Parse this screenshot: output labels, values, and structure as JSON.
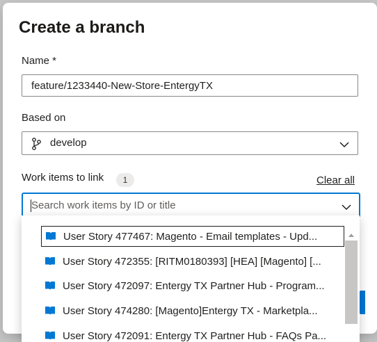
{
  "dialog": {
    "title": "Create a branch"
  },
  "name_field": {
    "label": "Name *",
    "value": "feature/1233440-New-Store-EntergyTX"
  },
  "based_on": {
    "label": "Based on",
    "value": "develop",
    "icon": "branch-icon"
  },
  "work_items": {
    "label": "Work items to link",
    "count": "1",
    "clear_all": "Clear all",
    "search_placeholder": "Search work items by ID or title",
    "results": [
      {
        "label": "User Story 477467: Magento - Email templates - Upd...",
        "icon": "book-icon"
      },
      {
        "label": "User Story 472355: [RITM0180393] [HEA] [Magento] [...",
        "icon": "book-icon"
      },
      {
        "label": "User Story 472097: Entergy TX Partner Hub - Program...",
        "icon": "book-icon"
      },
      {
        "label": "User Story 474280: [Magento]Entergy TX - Marketpla...",
        "icon": "book-icon"
      },
      {
        "label": "User Story 472091: Entergy TX Partner Hub - FAQs Pa...",
        "icon": "book-icon"
      }
    ]
  },
  "colors": {
    "accent": "#0078d4",
    "story_icon": "#0078d4",
    "text": "#201f1e",
    "border": "#8a8886"
  }
}
